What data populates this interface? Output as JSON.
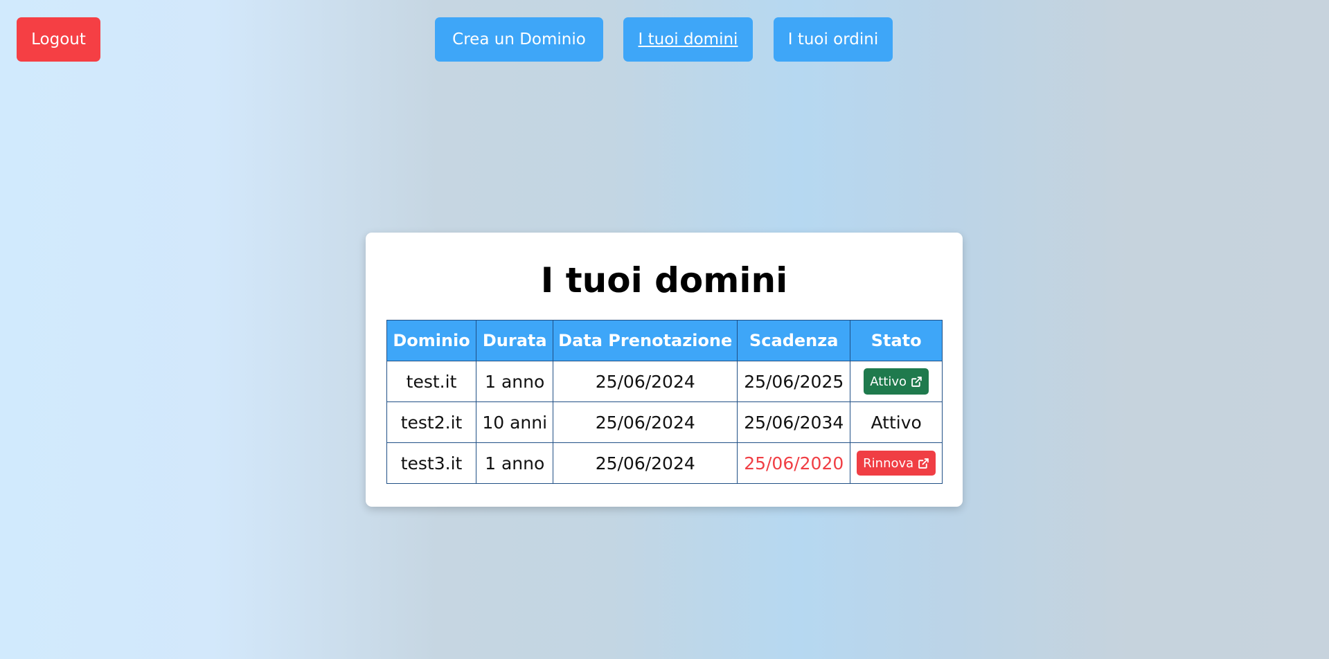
{
  "nav": {
    "logout_label": "Logout",
    "create_label": "Crea un Dominio",
    "domains_label": "I tuoi domini",
    "orders_label": "I tuoi ordini"
  },
  "card": {
    "title": "I tuoi domini"
  },
  "table": {
    "headers": [
      "Dominio",
      "Durata",
      "Data Prenotazione",
      "Scadenza",
      "Stato"
    ],
    "rows": [
      {
        "dominio": "test.it",
        "durata": "1 anno",
        "data": "25/06/2024",
        "scadenza": "25/06/2025",
        "stato": "Attivo",
        "stato_type": "button-active"
      },
      {
        "dominio": "test2.it",
        "durata": "10 anni",
        "data": "25/06/2024",
        "scadenza": "25/06/2034",
        "stato": "Attivo",
        "stato_type": "text"
      },
      {
        "dominio": "test3.it",
        "durata": "1 anno",
        "data": "25/06/2024",
        "scadenza": "25/06/2020",
        "stato": "Rinnova",
        "stato_type": "button-renew",
        "scadenza_expired": true
      }
    ]
  },
  "colors": {
    "background_left": "#d1eafd",
    "background_right": "#c7d3dd",
    "primary_button": "#3ea6f8",
    "danger": "#f53f44",
    "success": "#1f7a4d",
    "table_border": "#1f4f85"
  },
  "icons": {
    "external_link": "external-link-icon"
  }
}
